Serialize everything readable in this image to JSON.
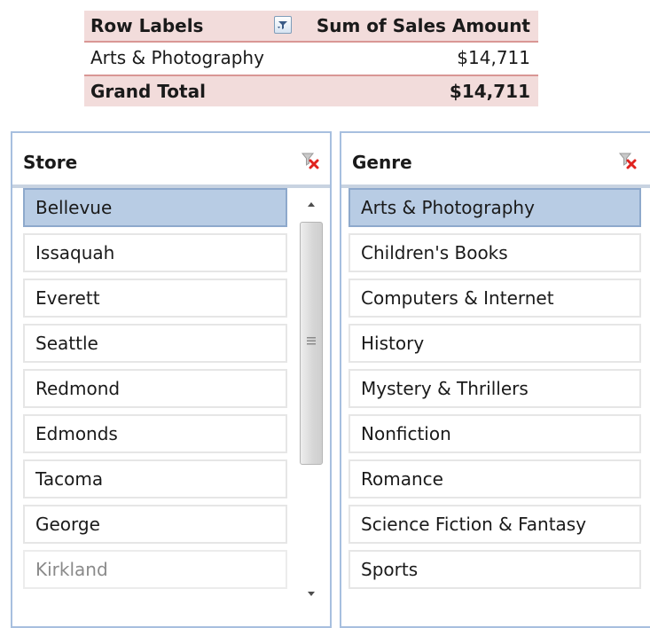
{
  "pivot": {
    "header_row_label": "Row Labels",
    "header_value_label": "Sum of Sales Amount",
    "rows": [
      {
        "label": "Arts & Photography",
        "value": "$14,711"
      }
    ],
    "grand_total_label": "Grand Total",
    "grand_total_value": "$14,711"
  },
  "slicers": {
    "store": {
      "title": "Store",
      "items": [
        {
          "label": "Bellevue",
          "state": "selected"
        },
        {
          "label": "Issaquah",
          "state": "normal"
        },
        {
          "label": "Everett",
          "state": "normal"
        },
        {
          "label": "Seattle",
          "state": "normal"
        },
        {
          "label": "Redmond",
          "state": "normal"
        },
        {
          "label": "Edmonds",
          "state": "normal"
        },
        {
          "label": "Tacoma",
          "state": "normal"
        },
        {
          "label": "George",
          "state": "normal"
        },
        {
          "label": "Kirkland",
          "state": "disabled"
        }
      ]
    },
    "genre": {
      "title": "Genre",
      "items": [
        {
          "label": "Arts & Photography",
          "state": "selected"
        },
        {
          "label": "Children's Books",
          "state": "normal"
        },
        {
          "label": "Computers & Internet",
          "state": "normal"
        },
        {
          "label": "History",
          "state": "normal"
        },
        {
          "label": "Mystery & Thrillers",
          "state": "normal"
        },
        {
          "label": "Nonfiction",
          "state": "normal"
        },
        {
          "label": "Romance",
          "state": "normal"
        },
        {
          "label": "Science Fiction & Fantasy",
          "state": "normal"
        },
        {
          "label": "Sports",
          "state": "normal"
        }
      ]
    }
  },
  "icons": {
    "row_filter": "filter-dropdown-icon",
    "clear_filter": "clear-filter-icon",
    "scroll_up": "scroll-up-arrow-icon",
    "scroll_down": "scroll-down-arrow-icon"
  },
  "colors": {
    "pivot_header_fill": "#f2dcdb",
    "pivot_border": "#d99795",
    "slicer_selected": "#b8cce4",
    "slicer_border": "#a7bfdf",
    "clear_filter_red": "#e0231f"
  }
}
